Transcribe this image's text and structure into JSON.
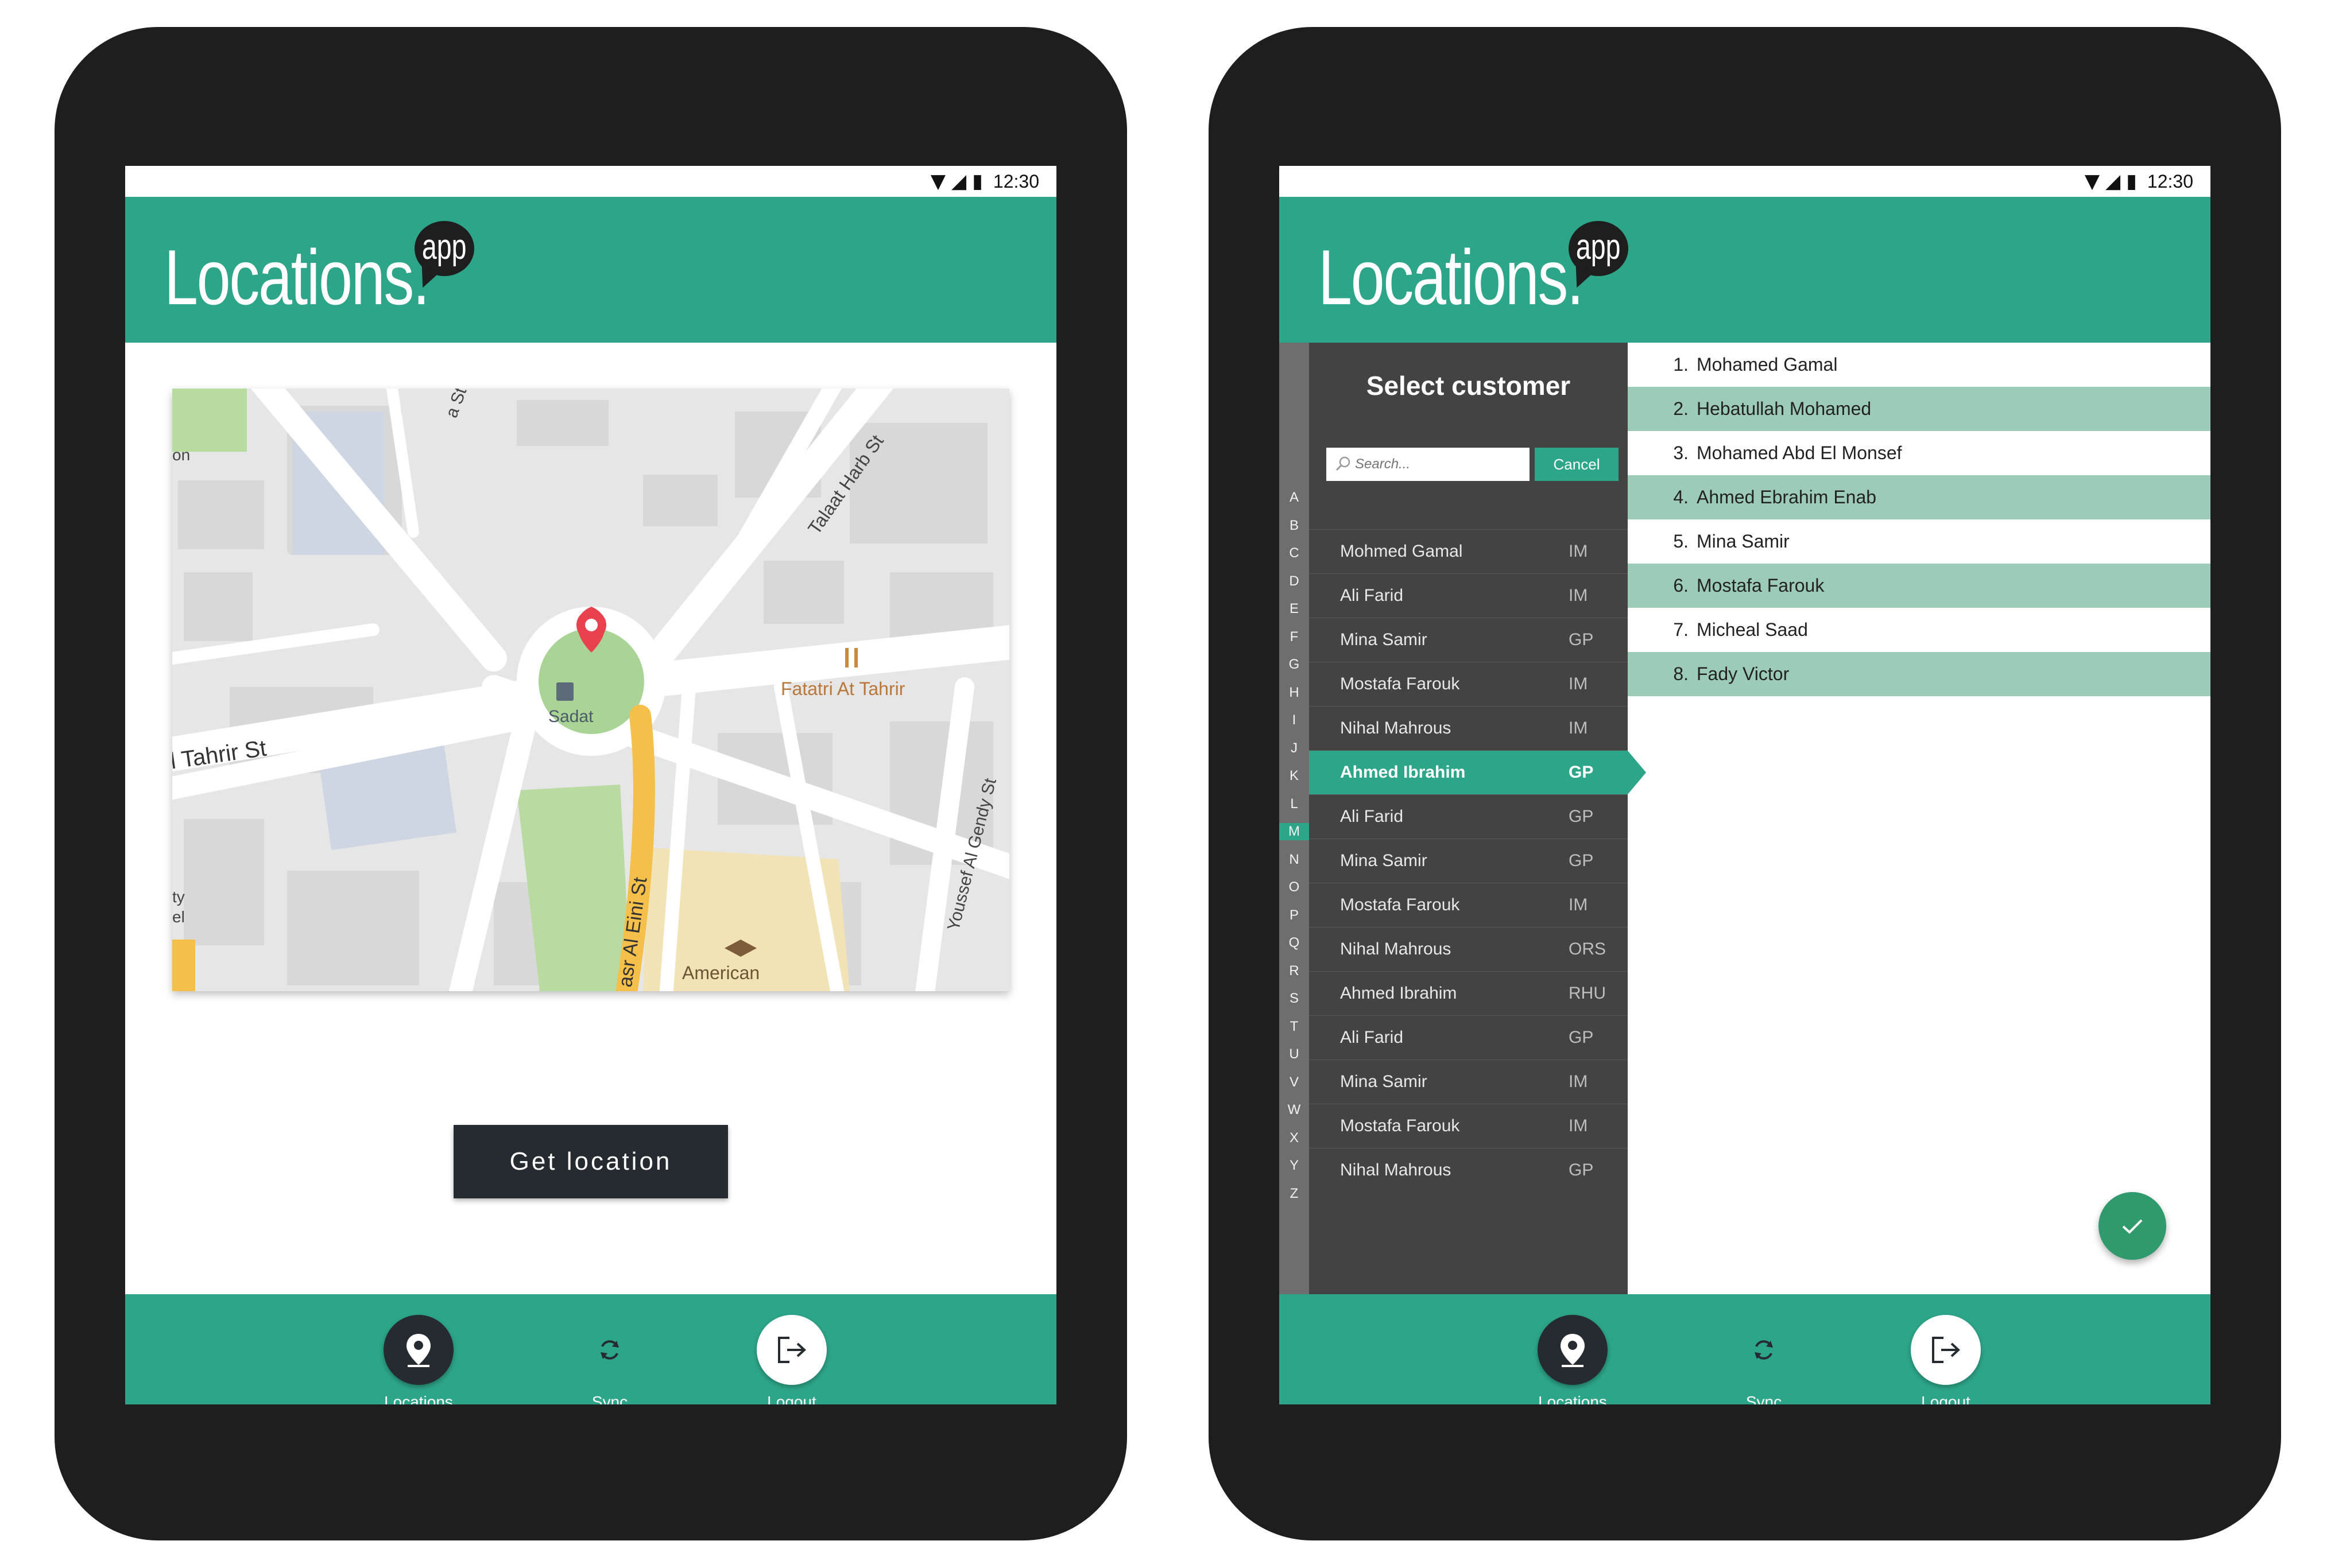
{
  "app": {
    "logo_word": "Locations.",
    "logo_badge": "app"
  },
  "status_bar": {
    "time": "12:30"
  },
  "colors": {
    "brand": "#2da588",
    "dark": "#252b31",
    "panel": "#434343",
    "highlight_row": "#9ccbb8",
    "bezel": "#1e1e1e"
  },
  "screen1": {
    "map": {
      "labels": {
        "tahrir_st": "l Tahrir St",
        "talaat_harb": "Talaat Harb St",
        "qasr_al_eini": "asr Al Eini St",
        "youssef_al_gendy": "Youssef Al Gendy St",
        "fatatri": "Fatatri At Tahrir",
        "sadat": "Sadat",
        "american": "American",
        "top_street": "a St",
        "edge_on": "on",
        "edge_ty": "ty",
        "edge_el": "el"
      }
    },
    "get_location_label": "Get location"
  },
  "bottom_nav": {
    "items": [
      {
        "label": "Locations",
        "icon": "map-pin-icon"
      },
      {
        "label": "Sync",
        "icon": "sync-icon"
      },
      {
        "label": "Logout",
        "icon": "logout-icon"
      }
    ]
  },
  "screen2": {
    "panel_title": "Select customer",
    "search_placeholder": "Search...",
    "cancel_label": "Cancel",
    "alphabet": [
      "A",
      "B",
      "C",
      "D",
      "E",
      "F",
      "G",
      "H",
      "I",
      "J",
      "K",
      "L",
      "M",
      "N",
      "O",
      "P",
      "Q",
      "R",
      "S",
      "T",
      "U",
      "V",
      "W",
      "X",
      "Y",
      "Z"
    ],
    "alphabet_active": "M",
    "customers": [
      {
        "name": "Mohmed Gamal",
        "code": "IM"
      },
      {
        "name": "Ali Farid",
        "code": "IM"
      },
      {
        "name": "Mina Samir",
        "code": "GP"
      },
      {
        "name": "Mostafa Farouk",
        "code": "IM"
      },
      {
        "name": "Nihal Mahrous",
        "code": "IM"
      },
      {
        "name": "Ahmed Ibrahim",
        "code": "GP"
      },
      {
        "name": "Ali Farid",
        "code": "GP"
      },
      {
        "name": "Mina Samir",
        "code": "GP"
      },
      {
        "name": "Mostafa Farouk",
        "code": "IM"
      },
      {
        "name": "Nihal Mahrous",
        "code": "ORS"
      },
      {
        "name": "Ahmed Ibrahim",
        "code": "RHU"
      },
      {
        "name": "Ali Farid",
        "code": "GP"
      },
      {
        "name": "Mina Samir",
        "code": "IM"
      },
      {
        "name": "Mostafa Farouk",
        "code": "IM"
      },
      {
        "name": "Nihal Mahrous",
        "code": "GP"
      }
    ],
    "selected_customer_index": 5,
    "picked": [
      {
        "num": "1.",
        "name": "Mohamed Gamal"
      },
      {
        "num": "2.",
        "name": "Hebatullah Mohamed"
      },
      {
        "num": "3.",
        "name": "Mohamed Abd El Monsef"
      },
      {
        "num": "4.",
        "name": "Ahmed Ebrahim Enab"
      },
      {
        "num": "5.",
        "name": "Mina Samir"
      },
      {
        "num": "6.",
        "name": "Mostafa Farouk"
      },
      {
        "num": "7.",
        "name": "Micheal Saad"
      },
      {
        "num": "8.",
        "name": "Fady Victor"
      }
    ]
  }
}
